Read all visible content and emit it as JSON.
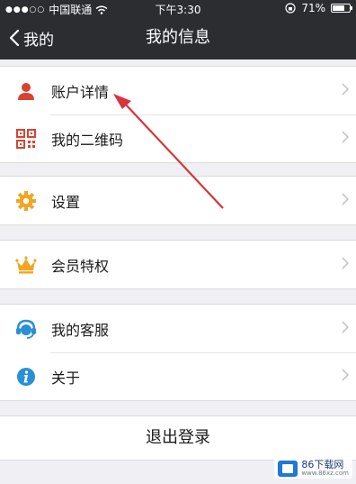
{
  "status_bar": {
    "signal_dots": "●●●○○",
    "carrier": "中国联通",
    "time": "下午3:30",
    "battery": "71%",
    "battery_level": 0.71
  },
  "nav": {
    "back_label": "我的",
    "title": "我的信息"
  },
  "groups": [
    {
      "items": [
        {
          "label": "账户详情",
          "icon": "person-icon",
          "color": "#d9432e"
        },
        {
          "label": "我的二维码",
          "icon": "qrcode-icon",
          "color": "#d9432e"
        }
      ]
    },
    {
      "items": [
        {
          "label": "设置",
          "icon": "gear-icon",
          "color": "#f0a623"
        }
      ]
    },
    {
      "items": [
        {
          "label": "会员特权",
          "icon": "crown-icon",
          "color": "#f0a623"
        }
      ]
    },
    {
      "items": [
        {
          "label": "我的客服",
          "icon": "customer-service-icon",
          "color": "#2a8fd6"
        },
        {
          "label": "关于",
          "icon": "info-icon",
          "color": "#2a8fd6"
        }
      ]
    }
  ],
  "logout_label": "退出登录",
  "watermark": {
    "text": "86下载网",
    "sub": "www.86xz.com"
  },
  "colors": {
    "nav_bg": "#2b2d31",
    "page_bg": "#efeff4",
    "annotation_arrow": "#d8343c"
  }
}
